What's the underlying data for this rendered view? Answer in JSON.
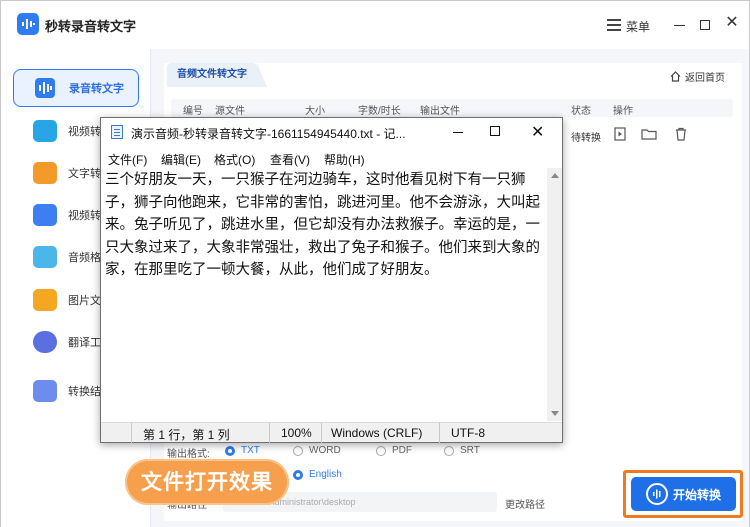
{
  "app": {
    "title": "秒转录音转文字",
    "menu_label": "菜单",
    "brand_color": "#2f7bf2"
  },
  "sidebar": {
    "items": [
      {
        "label": "录音转文字",
        "icon": "audio-wave-icon",
        "active": true
      },
      {
        "label": "视频转",
        "icon": "video-convert-icon"
      },
      {
        "label": "文字转",
        "icon": "text-to-speech-icon"
      },
      {
        "label": "视频转",
        "icon": "video-text-icon"
      },
      {
        "label": "音频格",
        "icon": "audio-format-icon"
      },
      {
        "label": "图片文",
        "icon": "image-text-icon"
      },
      {
        "label": "翻译工具",
        "icon": "translate-icon"
      },
      {
        "label": "转换结",
        "icon": "results-icon"
      }
    ]
  },
  "main": {
    "tab_label": "音频文件转文字",
    "back_home": "返回首页",
    "table": {
      "headers": [
        "编号",
        "源文件",
        "大小",
        "字数/时长",
        "输出文件",
        "状态",
        "操作"
      ],
      "row_status": "待转换"
    },
    "output": {
      "format_label": "输出格式:",
      "formats": [
        "TXT",
        "WORD",
        "PDF",
        "SRT"
      ],
      "selected_format": "TXT",
      "language": "English",
      "path_label": "输出路径",
      "path_value": "C:\\Users\\Administrator\\desktop",
      "change_path": "更改路径"
    },
    "start_button": "开始转换"
  },
  "overlay": {
    "badge_text": "文件打开效果"
  },
  "notepad": {
    "title": "演示音频-秒转录音转文字-1661154945440.txt - 记...",
    "menu": [
      "文件(F)",
      "编辑(E)",
      "格式(O)",
      "查看(V)",
      "帮助(H)"
    ],
    "content": "三个好朋友一天，一只猴子在河边骑车，这时他看见树下有一只狮子，狮子向他跑来，它非常的害怕，跳进河里。他不会游泳，大叫起来。兔子听见了，跳进水里，但它却没有办法救猴子。幸运的是，一只大象过来了，大象非常强壮，救出了兔子和猴子。他们来到大象的家，在那里吃了一顿大餐，从此，他们成了好朋友。",
    "status": {
      "position": "第 1 行，第 1 列",
      "zoom": "100%",
      "line_ending": "Windows (CRLF)",
      "encoding": "UTF-8"
    }
  }
}
